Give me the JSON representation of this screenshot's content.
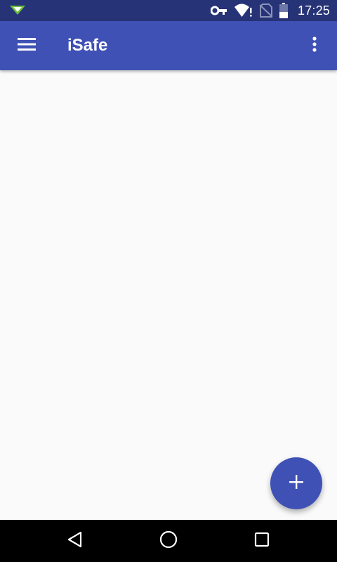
{
  "status_bar": {
    "time": "17:25",
    "icons": [
      "notification-app-icon",
      "vpn-key-icon",
      "wifi-alert-icon",
      "no-sim-icon",
      "battery-icon"
    ]
  },
  "app_bar": {
    "title": "iSafe",
    "color": "#3f51b5",
    "left_icon": "hamburger-menu-icon",
    "right_icon": "more-vert-icon"
  },
  "fab": {
    "icon": "plus-icon",
    "color": "#3f51b5"
  },
  "nav_bar": {
    "icons": [
      "back-triangle-icon",
      "home-circle-icon",
      "recents-square-icon"
    ]
  },
  "colors": {
    "status_bar": "#273377",
    "primary": "#3f51b5",
    "background": "#fafafa",
    "nav_bar": "#000000"
  }
}
